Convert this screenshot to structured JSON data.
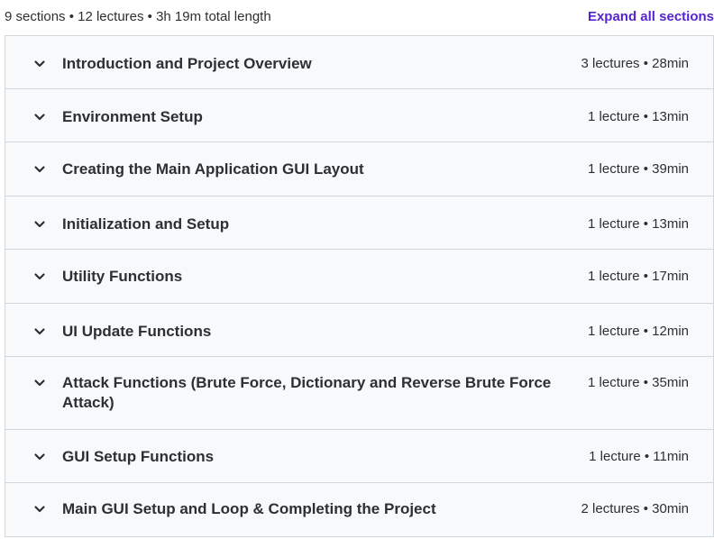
{
  "summary": {
    "text": "9 sections • 12 lectures • 3h 19m total length",
    "expand_label": "Expand all sections"
  },
  "sections": [
    {
      "title": "Introduction and Project Overview",
      "meta": "3 lectures • 28min"
    },
    {
      "title": "Environment Setup",
      "meta": "1 lecture • 13min"
    },
    {
      "title": "Creating the Main Application GUI Layout",
      "meta": "1 lecture • 39min"
    },
    {
      "title": "Initialization and Setup",
      "meta": "1 lecture • 13min"
    },
    {
      "title": "Utility Functions",
      "meta": "1 lecture • 17min"
    },
    {
      "title": "UI Update Functions",
      "meta": "1 lecture • 12min"
    },
    {
      "title": "Attack Functions (Brute Force, Dictionary and Reverse Brute Force Attack)",
      "meta": "1 lecture • 35min"
    },
    {
      "title": "GUI Setup Functions",
      "meta": "1 lecture • 11min"
    },
    {
      "title": "Main GUI Setup and Loop & Completing the Project",
      "meta": "2 lectures • 30min"
    }
  ],
  "icons": {
    "section_toggle": "chevron-down-icon"
  },
  "colors": {
    "accent": "#5624d0",
    "section_bg": "#f7f9fa",
    "border": "#d1d7dc",
    "text": "#2d2f31"
  }
}
